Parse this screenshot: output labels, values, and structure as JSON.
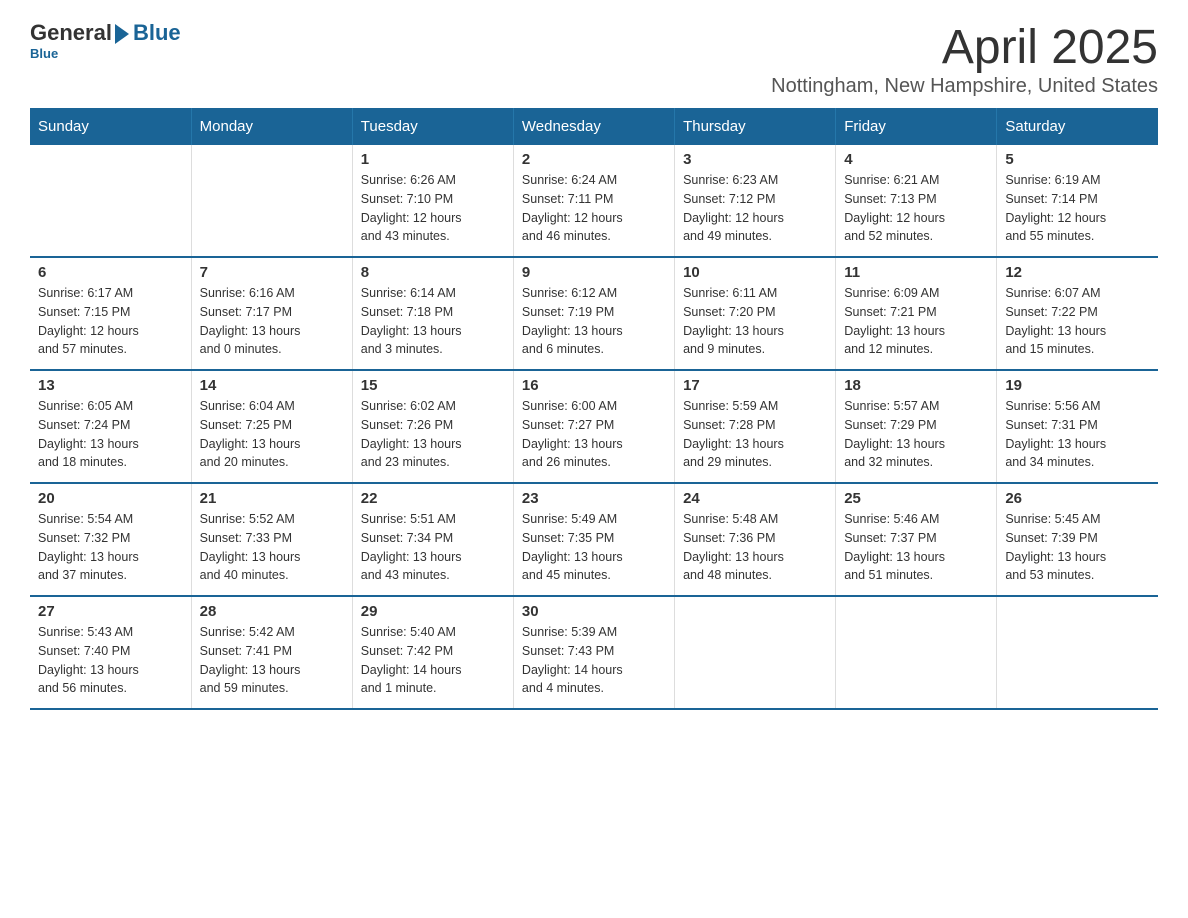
{
  "logo": {
    "general": "General",
    "blue": "Blue",
    "tagline": "Blue"
  },
  "title": {
    "month_year": "April 2025",
    "location": "Nottingham, New Hampshire, United States"
  },
  "weekdays": [
    "Sunday",
    "Monday",
    "Tuesday",
    "Wednesday",
    "Thursday",
    "Friday",
    "Saturday"
  ],
  "weeks": [
    [
      {
        "day": "",
        "info": ""
      },
      {
        "day": "",
        "info": ""
      },
      {
        "day": "1",
        "info": "Sunrise: 6:26 AM\nSunset: 7:10 PM\nDaylight: 12 hours\nand 43 minutes."
      },
      {
        "day": "2",
        "info": "Sunrise: 6:24 AM\nSunset: 7:11 PM\nDaylight: 12 hours\nand 46 minutes."
      },
      {
        "day": "3",
        "info": "Sunrise: 6:23 AM\nSunset: 7:12 PM\nDaylight: 12 hours\nand 49 minutes."
      },
      {
        "day": "4",
        "info": "Sunrise: 6:21 AM\nSunset: 7:13 PM\nDaylight: 12 hours\nand 52 minutes."
      },
      {
        "day": "5",
        "info": "Sunrise: 6:19 AM\nSunset: 7:14 PM\nDaylight: 12 hours\nand 55 minutes."
      }
    ],
    [
      {
        "day": "6",
        "info": "Sunrise: 6:17 AM\nSunset: 7:15 PM\nDaylight: 12 hours\nand 57 minutes."
      },
      {
        "day": "7",
        "info": "Sunrise: 6:16 AM\nSunset: 7:17 PM\nDaylight: 13 hours\nand 0 minutes."
      },
      {
        "day": "8",
        "info": "Sunrise: 6:14 AM\nSunset: 7:18 PM\nDaylight: 13 hours\nand 3 minutes."
      },
      {
        "day": "9",
        "info": "Sunrise: 6:12 AM\nSunset: 7:19 PM\nDaylight: 13 hours\nand 6 minutes."
      },
      {
        "day": "10",
        "info": "Sunrise: 6:11 AM\nSunset: 7:20 PM\nDaylight: 13 hours\nand 9 minutes."
      },
      {
        "day": "11",
        "info": "Sunrise: 6:09 AM\nSunset: 7:21 PM\nDaylight: 13 hours\nand 12 minutes."
      },
      {
        "day": "12",
        "info": "Sunrise: 6:07 AM\nSunset: 7:22 PM\nDaylight: 13 hours\nand 15 minutes."
      }
    ],
    [
      {
        "day": "13",
        "info": "Sunrise: 6:05 AM\nSunset: 7:24 PM\nDaylight: 13 hours\nand 18 minutes."
      },
      {
        "day": "14",
        "info": "Sunrise: 6:04 AM\nSunset: 7:25 PM\nDaylight: 13 hours\nand 20 minutes."
      },
      {
        "day": "15",
        "info": "Sunrise: 6:02 AM\nSunset: 7:26 PM\nDaylight: 13 hours\nand 23 minutes."
      },
      {
        "day": "16",
        "info": "Sunrise: 6:00 AM\nSunset: 7:27 PM\nDaylight: 13 hours\nand 26 minutes."
      },
      {
        "day": "17",
        "info": "Sunrise: 5:59 AM\nSunset: 7:28 PM\nDaylight: 13 hours\nand 29 minutes."
      },
      {
        "day": "18",
        "info": "Sunrise: 5:57 AM\nSunset: 7:29 PM\nDaylight: 13 hours\nand 32 minutes."
      },
      {
        "day": "19",
        "info": "Sunrise: 5:56 AM\nSunset: 7:31 PM\nDaylight: 13 hours\nand 34 minutes."
      }
    ],
    [
      {
        "day": "20",
        "info": "Sunrise: 5:54 AM\nSunset: 7:32 PM\nDaylight: 13 hours\nand 37 minutes."
      },
      {
        "day": "21",
        "info": "Sunrise: 5:52 AM\nSunset: 7:33 PM\nDaylight: 13 hours\nand 40 minutes."
      },
      {
        "day": "22",
        "info": "Sunrise: 5:51 AM\nSunset: 7:34 PM\nDaylight: 13 hours\nand 43 minutes."
      },
      {
        "day": "23",
        "info": "Sunrise: 5:49 AM\nSunset: 7:35 PM\nDaylight: 13 hours\nand 45 minutes."
      },
      {
        "day": "24",
        "info": "Sunrise: 5:48 AM\nSunset: 7:36 PM\nDaylight: 13 hours\nand 48 minutes."
      },
      {
        "day": "25",
        "info": "Sunrise: 5:46 AM\nSunset: 7:37 PM\nDaylight: 13 hours\nand 51 minutes."
      },
      {
        "day": "26",
        "info": "Sunrise: 5:45 AM\nSunset: 7:39 PM\nDaylight: 13 hours\nand 53 minutes."
      }
    ],
    [
      {
        "day": "27",
        "info": "Sunrise: 5:43 AM\nSunset: 7:40 PM\nDaylight: 13 hours\nand 56 minutes."
      },
      {
        "day": "28",
        "info": "Sunrise: 5:42 AM\nSunset: 7:41 PM\nDaylight: 13 hours\nand 59 minutes."
      },
      {
        "day": "29",
        "info": "Sunrise: 5:40 AM\nSunset: 7:42 PM\nDaylight: 14 hours\nand 1 minute."
      },
      {
        "day": "30",
        "info": "Sunrise: 5:39 AM\nSunset: 7:43 PM\nDaylight: 14 hours\nand 4 minutes."
      },
      {
        "day": "",
        "info": ""
      },
      {
        "day": "",
        "info": ""
      },
      {
        "day": "",
        "info": ""
      }
    ]
  ]
}
